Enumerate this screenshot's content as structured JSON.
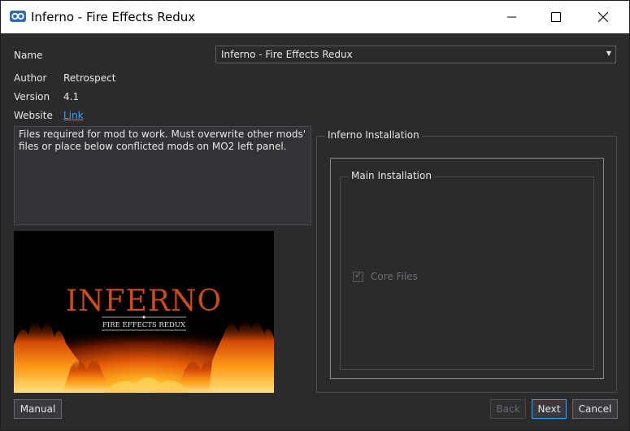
{
  "window": {
    "title": "Inferno - Fire Effects Redux",
    "app_icon": "mo2-icon",
    "controls": [
      "minimize-icon",
      "maximize-icon",
      "close-icon"
    ]
  },
  "info": {
    "name_label": "Name",
    "name_value": "Inferno - Fire Effects Redux",
    "author_label": "Author",
    "author_value": "Retrospect",
    "version_label": "Version",
    "version_value": "4.1",
    "website_label": "Website",
    "website_link": "Link"
  },
  "description": "Files required for mod to work. Must overwrite other mods' files or place below conflicted mods on MO2 left panel.",
  "preview": {
    "logo_title": "INFERNO",
    "logo_subtitle": "FIRE EFFECTS REDUX"
  },
  "installation": {
    "group_title": "Inferno Installation",
    "subgroup_title": "Main Installation",
    "options": [
      {
        "label": "Core Files",
        "checked": true,
        "enabled": false
      }
    ]
  },
  "buttons": {
    "manual": "Manual",
    "back": "Back",
    "next": "Next",
    "cancel": "Cancel"
  },
  "colors": {
    "background": "#2b2b2e",
    "accent": "#3b9ef5",
    "text": "#e6e6e6"
  }
}
